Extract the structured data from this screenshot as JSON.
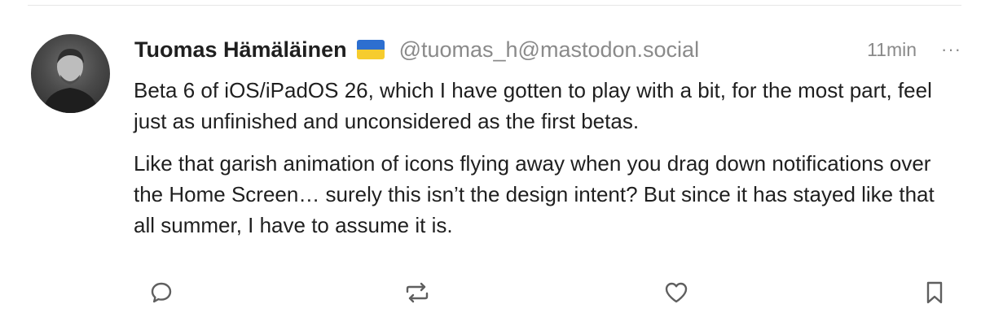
{
  "post": {
    "author": {
      "display_name": "Tuomas Hämäläinen",
      "handle": "@tuomas_h@mastodon.social",
      "flag_icon": "ukraine-flag-icon"
    },
    "timestamp": "11min",
    "more_label": "···",
    "paragraphs": [
      "Beta 6 of iOS/iPadOS 26, which I have gotten to play with a bit, for the most part, feel just as unfinished and unconsidered as the first betas.",
      "Like that garish animation of icons flying away when you drag down notifications over the Home Screen… surely this isn’t the design intent? But since it has stayed like that all summer, I have to assume it is."
    ],
    "actions": {
      "reply_icon": "reply-icon",
      "boost_icon": "boost-icon",
      "favourite_icon": "heart-icon",
      "bookmark_icon": "bookmark-icon"
    }
  },
  "colors": {
    "text": "#1f1f1f",
    "muted": "#8a8a8a",
    "icon": "#5f5f5f",
    "flag_blue": "#2d6fd0",
    "flag_yellow": "#f6cc2e"
  }
}
